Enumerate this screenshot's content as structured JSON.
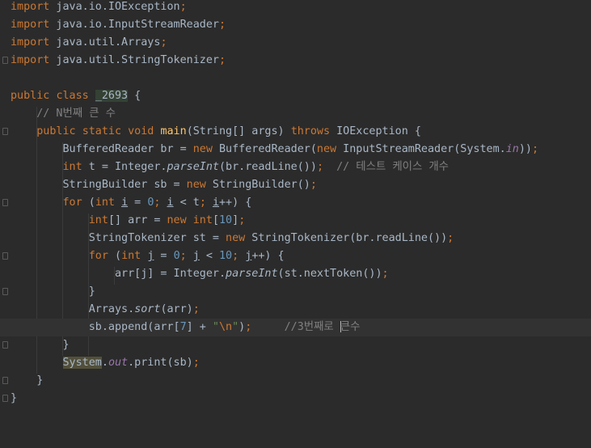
{
  "editor": {
    "language": "java",
    "theme": "dark",
    "lines": [
      {
        "text": "import java.io.IOException;"
      },
      {
        "text": "import java.io.InputStreamReader;"
      },
      {
        "text": "import java.util.Arrays;"
      },
      {
        "text": "import java.util.StringTokenizer;"
      },
      {
        "text": ""
      },
      {
        "text": "public class _2693 {"
      },
      {
        "text": "    // N번째 큰 수"
      },
      {
        "text": "    public static void main(String[] args) throws IOException {"
      },
      {
        "text": "        BufferedReader br = new BufferedReader(new InputStreamReader(System.in));"
      },
      {
        "text": "        int t = Integer.parseInt(br.readLine());  // 테스트 케이스 개수"
      },
      {
        "text": "        StringBuilder sb = new StringBuilder();"
      },
      {
        "text": "        for (int i = 0; i < t; i++) {"
      },
      {
        "text": "            int[] arr = new int[10];"
      },
      {
        "text": "            StringTokenizer st = new StringTokenizer(br.readLine());"
      },
      {
        "text": "            for (int j = 0; j < 10; j++) {"
      },
      {
        "text": "                arr[j] = Integer.parseInt(st.nextToken());"
      },
      {
        "text": "            }"
      },
      {
        "text": "            Arrays.sort(arr);"
      },
      {
        "text": "            sb.append(arr[7] + \"\\n\");     //3번째로 큰수"
      },
      {
        "text": "        }"
      },
      {
        "text": "        System.out.print(sb);"
      },
      {
        "text": "    }"
      },
      {
        "text": "}"
      }
    ],
    "current_line": 18,
    "intention_icon": "lightbulb-icon"
  },
  "colors": {
    "background": "#2b2b2b",
    "keyword": "#cc7832",
    "string": "#6a8759",
    "number": "#6897bb",
    "comment": "#808080",
    "method_decl": "#ffc66d",
    "field": "#9876aa",
    "text": "#a9b7c6"
  }
}
